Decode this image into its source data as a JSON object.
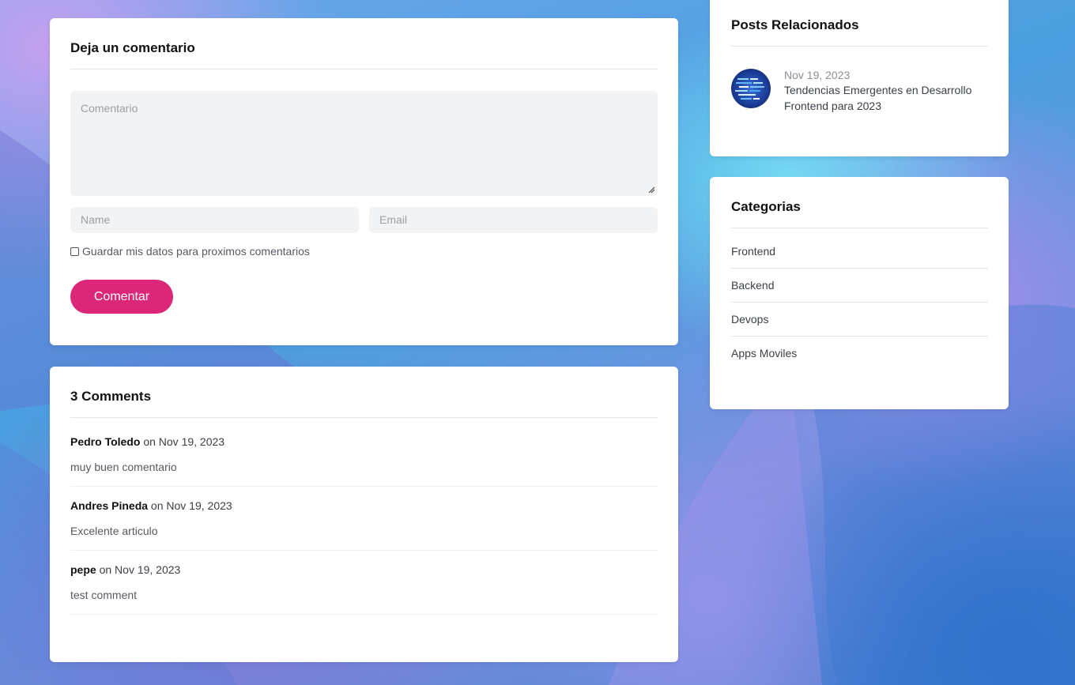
{
  "colors": {
    "accent": "#dc2779",
    "card_bg": "#ffffff",
    "input_bg": "#f2f3f5"
  },
  "comment_form": {
    "title": "Deja un comentario",
    "comment_placeholder": "Comentario",
    "name_placeholder": "Name",
    "email_placeholder": "Email",
    "save_data_label": "Guardar mis datos para proximos comentarios",
    "save_data_checked": false,
    "submit_label": "Comentar"
  },
  "comments": {
    "title": "3 Comments",
    "items": [
      {
        "author": "Pedro Toledo",
        "on": "on",
        "date": "Nov 19, 2023",
        "text": "muy buen comentario"
      },
      {
        "author": "Andres Pineda",
        "on": "on",
        "date": "Nov 19, 2023",
        "text": "Excelente articulo"
      },
      {
        "author": "pepe",
        "on": "on",
        "date": "Nov 19, 2023",
        "text": "test comment"
      }
    ]
  },
  "related_posts": {
    "title": "Posts Relacionados",
    "items": [
      {
        "date": "Nov 19, 2023",
        "title": "Tendencias Emergentes en Desarrollo Frontend para 2023",
        "thumbnail_icon": "code-screen-thumbnail"
      }
    ]
  },
  "categories": {
    "title": "Categorias",
    "items": [
      "Frontend",
      "Backend",
      "Devops",
      "Apps Moviles"
    ]
  }
}
